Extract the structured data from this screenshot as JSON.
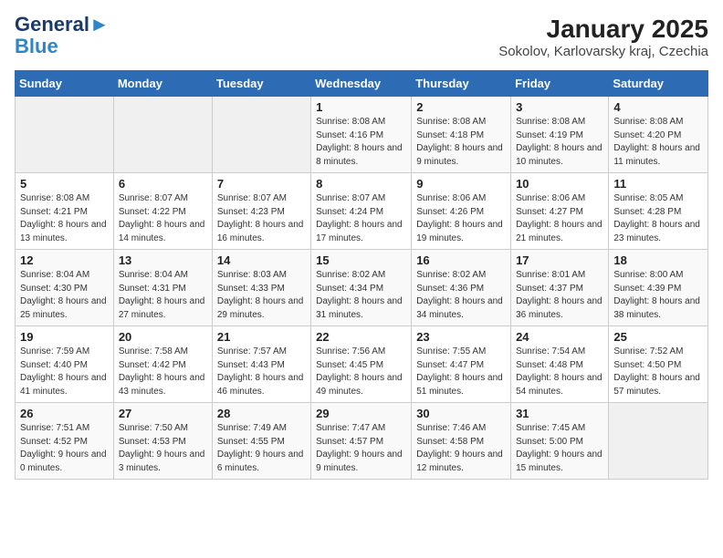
{
  "header": {
    "logo_line1": "General",
    "logo_line2": "Blue",
    "title": "January 2025",
    "subtitle": "Sokolov, Karlovarsky kraj, Czechia"
  },
  "weekdays": [
    "Sunday",
    "Monday",
    "Tuesday",
    "Wednesday",
    "Thursday",
    "Friday",
    "Saturday"
  ],
  "weeks": [
    [
      {
        "day": "",
        "detail": ""
      },
      {
        "day": "",
        "detail": ""
      },
      {
        "day": "",
        "detail": ""
      },
      {
        "day": "1",
        "detail": "Sunrise: 8:08 AM\nSunset: 4:16 PM\nDaylight: 8 hours\nand 8 minutes."
      },
      {
        "day": "2",
        "detail": "Sunrise: 8:08 AM\nSunset: 4:18 PM\nDaylight: 8 hours\nand 9 minutes."
      },
      {
        "day": "3",
        "detail": "Sunrise: 8:08 AM\nSunset: 4:19 PM\nDaylight: 8 hours\nand 10 minutes."
      },
      {
        "day": "4",
        "detail": "Sunrise: 8:08 AM\nSunset: 4:20 PM\nDaylight: 8 hours\nand 11 minutes."
      }
    ],
    [
      {
        "day": "5",
        "detail": "Sunrise: 8:08 AM\nSunset: 4:21 PM\nDaylight: 8 hours\nand 13 minutes."
      },
      {
        "day": "6",
        "detail": "Sunrise: 8:07 AM\nSunset: 4:22 PM\nDaylight: 8 hours\nand 14 minutes."
      },
      {
        "day": "7",
        "detail": "Sunrise: 8:07 AM\nSunset: 4:23 PM\nDaylight: 8 hours\nand 16 minutes."
      },
      {
        "day": "8",
        "detail": "Sunrise: 8:07 AM\nSunset: 4:24 PM\nDaylight: 8 hours\nand 17 minutes."
      },
      {
        "day": "9",
        "detail": "Sunrise: 8:06 AM\nSunset: 4:26 PM\nDaylight: 8 hours\nand 19 minutes."
      },
      {
        "day": "10",
        "detail": "Sunrise: 8:06 AM\nSunset: 4:27 PM\nDaylight: 8 hours\nand 21 minutes."
      },
      {
        "day": "11",
        "detail": "Sunrise: 8:05 AM\nSunset: 4:28 PM\nDaylight: 8 hours\nand 23 minutes."
      }
    ],
    [
      {
        "day": "12",
        "detail": "Sunrise: 8:04 AM\nSunset: 4:30 PM\nDaylight: 8 hours\nand 25 minutes."
      },
      {
        "day": "13",
        "detail": "Sunrise: 8:04 AM\nSunset: 4:31 PM\nDaylight: 8 hours\nand 27 minutes."
      },
      {
        "day": "14",
        "detail": "Sunrise: 8:03 AM\nSunset: 4:33 PM\nDaylight: 8 hours\nand 29 minutes."
      },
      {
        "day": "15",
        "detail": "Sunrise: 8:02 AM\nSunset: 4:34 PM\nDaylight: 8 hours\nand 31 minutes."
      },
      {
        "day": "16",
        "detail": "Sunrise: 8:02 AM\nSunset: 4:36 PM\nDaylight: 8 hours\nand 34 minutes."
      },
      {
        "day": "17",
        "detail": "Sunrise: 8:01 AM\nSunset: 4:37 PM\nDaylight: 8 hours\nand 36 minutes."
      },
      {
        "day": "18",
        "detail": "Sunrise: 8:00 AM\nSunset: 4:39 PM\nDaylight: 8 hours\nand 38 minutes."
      }
    ],
    [
      {
        "day": "19",
        "detail": "Sunrise: 7:59 AM\nSunset: 4:40 PM\nDaylight: 8 hours\nand 41 minutes."
      },
      {
        "day": "20",
        "detail": "Sunrise: 7:58 AM\nSunset: 4:42 PM\nDaylight: 8 hours\nand 43 minutes."
      },
      {
        "day": "21",
        "detail": "Sunrise: 7:57 AM\nSunset: 4:43 PM\nDaylight: 8 hours\nand 46 minutes."
      },
      {
        "day": "22",
        "detail": "Sunrise: 7:56 AM\nSunset: 4:45 PM\nDaylight: 8 hours\nand 49 minutes."
      },
      {
        "day": "23",
        "detail": "Sunrise: 7:55 AM\nSunset: 4:47 PM\nDaylight: 8 hours\nand 51 minutes."
      },
      {
        "day": "24",
        "detail": "Sunrise: 7:54 AM\nSunset: 4:48 PM\nDaylight: 8 hours\nand 54 minutes."
      },
      {
        "day": "25",
        "detail": "Sunrise: 7:52 AM\nSunset: 4:50 PM\nDaylight: 8 hours\nand 57 minutes."
      }
    ],
    [
      {
        "day": "26",
        "detail": "Sunrise: 7:51 AM\nSunset: 4:52 PM\nDaylight: 9 hours\nand 0 minutes."
      },
      {
        "day": "27",
        "detail": "Sunrise: 7:50 AM\nSunset: 4:53 PM\nDaylight: 9 hours\nand 3 minutes."
      },
      {
        "day": "28",
        "detail": "Sunrise: 7:49 AM\nSunset: 4:55 PM\nDaylight: 9 hours\nand 6 minutes."
      },
      {
        "day": "29",
        "detail": "Sunrise: 7:47 AM\nSunset: 4:57 PM\nDaylight: 9 hours\nand 9 minutes."
      },
      {
        "day": "30",
        "detail": "Sunrise: 7:46 AM\nSunset: 4:58 PM\nDaylight: 9 hours\nand 12 minutes."
      },
      {
        "day": "31",
        "detail": "Sunrise: 7:45 AM\nSunset: 5:00 PM\nDaylight: 9 hours\nand 15 minutes."
      },
      {
        "day": "",
        "detail": ""
      }
    ]
  ]
}
